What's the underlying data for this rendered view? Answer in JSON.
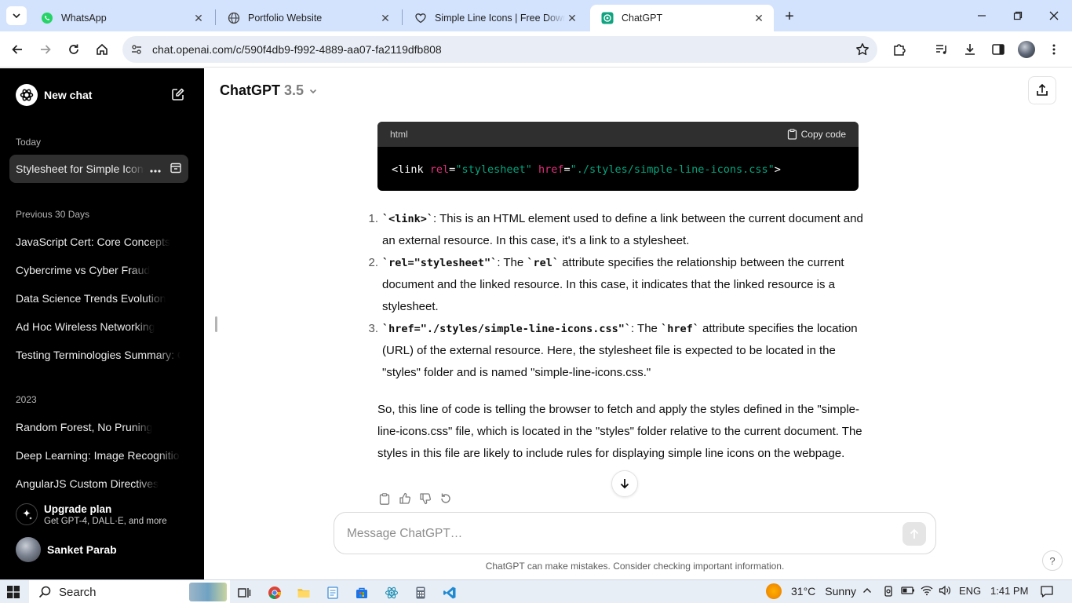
{
  "browser": {
    "tabs": [
      {
        "title": "WhatsApp",
        "icon": "whatsapp-icon"
      },
      {
        "title": "Portfolio Website",
        "icon": "globe-icon"
      },
      {
        "title": "Simple Line Icons | Free Downlo",
        "icon": "heart-icon"
      },
      {
        "title": "ChatGPT",
        "icon": "chatgpt-icon",
        "active": true
      }
    ],
    "url": "chat.openai.com/c/590f4db9-f992-4889-aa07-fa2119dfb808"
  },
  "sidebar": {
    "new_chat": "New chat",
    "sections": [
      {
        "title": "Today",
        "items": [
          "Stylesheet for Simple Icons"
        ]
      },
      {
        "title": "Previous 30 Days",
        "items": [
          "JavaScript Cert: Core Concepts",
          "Cybercrime vs Cyber Fraud",
          "Data Science Trends Evolution",
          "Ad Hoc Wireless Networking",
          "Testing Terminologies Summary: C"
        ]
      },
      {
        "title": "2023",
        "items": [
          "Random Forest, No Pruning",
          "Deep Learning: Image Recognition",
          "AngularJS Custom Directives"
        ]
      }
    ],
    "upgrade": {
      "title": "Upgrade plan",
      "subtitle": "Get GPT-4, DALL·E, and more"
    },
    "user": "Sanket Parab"
  },
  "main": {
    "model_name": "ChatGPT",
    "model_version": "3.5",
    "code_block": {
      "language": "html",
      "copy_label": "Copy code",
      "code": {
        "open": "<link ",
        "attr1": "rel",
        "eq1": "=",
        "val1": "\"stylesheet\"",
        "sp": " ",
        "attr2": "href",
        "eq2": "=",
        "val2": "\"./styles/simple-line-icons.css\"",
        "close": ">"
      }
    },
    "list": [
      {
        "num": "1.",
        "code": "`<link>`",
        "text": ": This is an HTML element used to define a link between the current document and an external resource. In this case, it's a link to a stylesheet."
      },
      {
        "num": "2.",
        "code": "`rel=\"stylesheet\"`",
        "text_a": ": The ",
        "code_b": "`rel`",
        "text": " attribute specifies the relationship between the current document and the linked resource. In this case, it indicates that the linked resource is a stylesheet."
      },
      {
        "num": "3.",
        "code": "`href=\"./styles/simple-line-icons.css\"`",
        "text_a": ": The ",
        "code_b": "`href`",
        "text": " attribute specifies the location (URL) of the external resource. Here, the stylesheet file is expected to be located in the \"styles\" folder and is named \"simple-line-icons.css.\""
      }
    ],
    "summary": "So, this line of code is telling the browser to fetch and apply the styles defined in the \"simple-line-icons.css\" file, which is located in the \"styles\" folder relative to the current document. The styles in this file are likely to include rules for displaying simple line icons on the webpage.",
    "composer_placeholder": "Message ChatGPT…",
    "disclaimer": "ChatGPT can make mistakes. Consider checking important information.",
    "help": "?"
  },
  "taskbar": {
    "search": "Search",
    "temperature": "31°C",
    "condition": "Sunny",
    "language": "ENG",
    "time": "1:41 PM"
  },
  "colors": {
    "tabstrip": "#d3e3fd",
    "sidebar": "#000000",
    "code_attr": "#df3079",
    "code_string": "#00a67d"
  }
}
